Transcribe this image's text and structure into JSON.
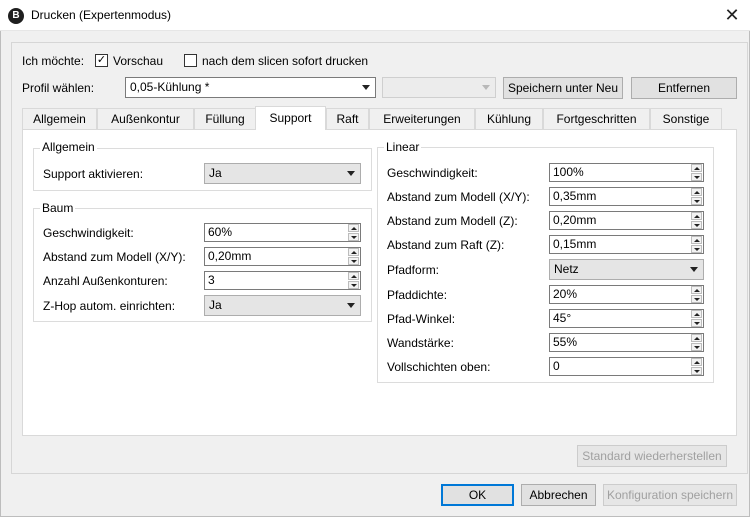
{
  "window": {
    "title": "Drucken (Expertenmodus)",
    "icon_letter": "B",
    "close_glyph": "✕"
  },
  "top": {
    "want_label": "Ich möchte:",
    "preview_label": "Vorschau",
    "preview_checked": true,
    "print_after_slice_label": "nach dem slicen sofort drucken",
    "print_after_slice_checked": false,
    "check_glyph": "✓",
    "profile_label": "Profil wählen:",
    "profile_value": "0,05-Kühlung *",
    "secondary_value": "",
    "save_as_new": "Speichern unter Neu",
    "remove": "Entfernen"
  },
  "tabs": [
    "Allgemein",
    "Außenkontur",
    "Füllung",
    "Support",
    "Raft",
    "Erweiterungen",
    "Kühlung",
    "Fortgeschritten",
    "Sonstige"
  ],
  "active_tab": "Support",
  "general_group": {
    "title": "Allgemein",
    "support_label": "Support aktivieren:",
    "support_value": "Ja"
  },
  "tree_group": {
    "title": "Baum",
    "speed_label": "Geschwindigkeit:",
    "speed_value": "60%",
    "distance_xy_label": "Abstand zum Modell (X/Y):",
    "distance_xy_value": "0,20mm",
    "outer_count_label": "Anzahl Außenkonturen:",
    "outer_count_value": "3",
    "zhop_label": "Z-Hop autom. einrichten:",
    "zhop_value": "Ja"
  },
  "linear_group": {
    "title": "Linear",
    "speed_label": "Geschwindigkeit:",
    "speed_value": "100%",
    "distance_xy_label": "Abstand zum Modell (X/Y):",
    "distance_xy_value": "0,35mm",
    "distance_z_label": "Abstand zum Modell (Z):",
    "distance_z_value": "0,20mm",
    "distance_raft_label": "Abstand zum Raft (Z):",
    "distance_raft_value": "0,15mm",
    "pattern_label": "Pfadform:",
    "pattern_value": "Netz",
    "density_label": "Pfaddichte:",
    "density_value": "20%",
    "angle_label": "Pfad-Winkel:",
    "angle_value": "45°",
    "wall_label": "Wandstärke:",
    "wall_value": "55%",
    "top_layers_label": "Vollschichten oben:",
    "top_layers_value": "0"
  },
  "buttons": {
    "restore_defaults": "Standard wiederherstellen",
    "ok": "OK",
    "cancel": "Abbrechen",
    "save_config": "Konfiguration speichern"
  }
}
